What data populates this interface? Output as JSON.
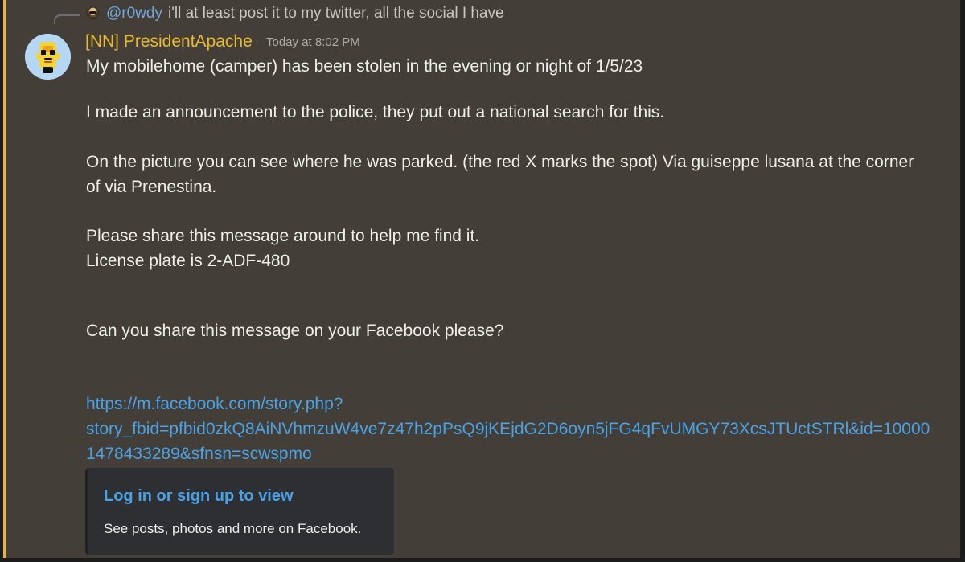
{
  "reply": {
    "author": "@r0wdy",
    "text": "i'll at least post it to my twitter, all the social I have"
  },
  "message": {
    "author": "[NN] PresidentApache",
    "timestamp": "Today at 8:02 PM",
    "lines": {
      "line1": "My mobilehome (camper) has been stolen in the evening or night of 1/5/23",
      "line2": "I made an announcement to the police, they put out a national search for this.",
      "line3": "On the picture you can see where he was parked. (the red X marks the spot) Via guiseppe lusana at the corner",
      "line4": "of via Prenestina.",
      "line5": "Please share this message around to help me find it.",
      "line6": "License plate is 2-ADF-480",
      "line7": "Can you share this message on your Facebook please?"
    },
    "link": {
      "line1": "https://m.facebook.com/story.php?",
      "line2": "story_fbid=pfbid0zkQ8AiNVhmzuW4ve7z47h2pPsQ9jKEjdG2D6oyn5jFG4qFvUMGY73XcsJTUctSTRl&id=10000",
      "line3": "1478433289&sfnsn=scwspmo"
    }
  },
  "embed": {
    "title": "Log in or sign up to view",
    "description": "See posts, photos and more on Facebook."
  },
  "colors": {
    "background": "#433f38",
    "accent": "#f0b232",
    "link": "#4aa2e6",
    "username": "#e9b92f"
  },
  "icons": {
    "reply_avatar": "user-avatar-icon",
    "main_avatar": "duck-avatar-icon"
  }
}
